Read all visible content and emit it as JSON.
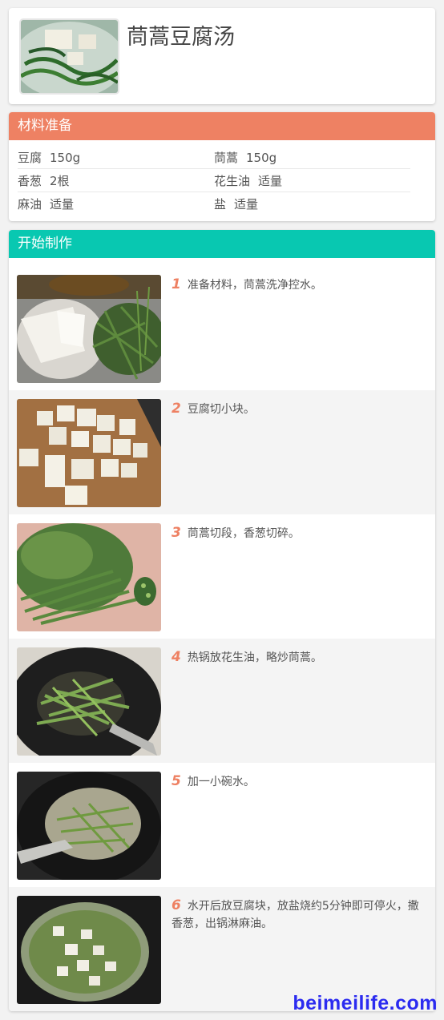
{
  "recipe": {
    "title": "茼蒿豆腐汤"
  },
  "ingredients": {
    "header": "材料准备",
    "rows": [
      [
        {
          "name": "豆腐",
          "qty": "150g"
        },
        {
          "name": "茼蒿",
          "qty": "150g"
        }
      ],
      [
        {
          "name": "香葱",
          "qty": "2根"
        },
        {
          "name": "花生油",
          "qty": "适量"
        }
      ],
      [
        {
          "name": "麻油",
          "qty": "适量"
        },
        {
          "name": "盐",
          "qty": "适量"
        }
      ]
    ]
  },
  "steps": {
    "header": "开始制作",
    "items": [
      {
        "num": "1",
        "text": "准备材料，茼蒿洗净控水。"
      },
      {
        "num": "2",
        "text": "豆腐切小块。"
      },
      {
        "num": "3",
        "text": "茼蒿切段，香葱切碎。"
      },
      {
        "num": "4",
        "text": "热锅放花生油，略炒茼蒿。"
      },
      {
        "num": "5",
        "text": "加一小碗水。"
      },
      {
        "num": "6",
        "text": "水开后放豆腐块，放盐烧约5分钟即可停火，撒香葱，出锅淋麻油。"
      }
    ]
  },
  "watermark": "beimeilife.com",
  "colors": {
    "ingredients_bar": "#ee8163",
    "steps_bar": "#08c8b1",
    "step_number": "#ee8163"
  }
}
